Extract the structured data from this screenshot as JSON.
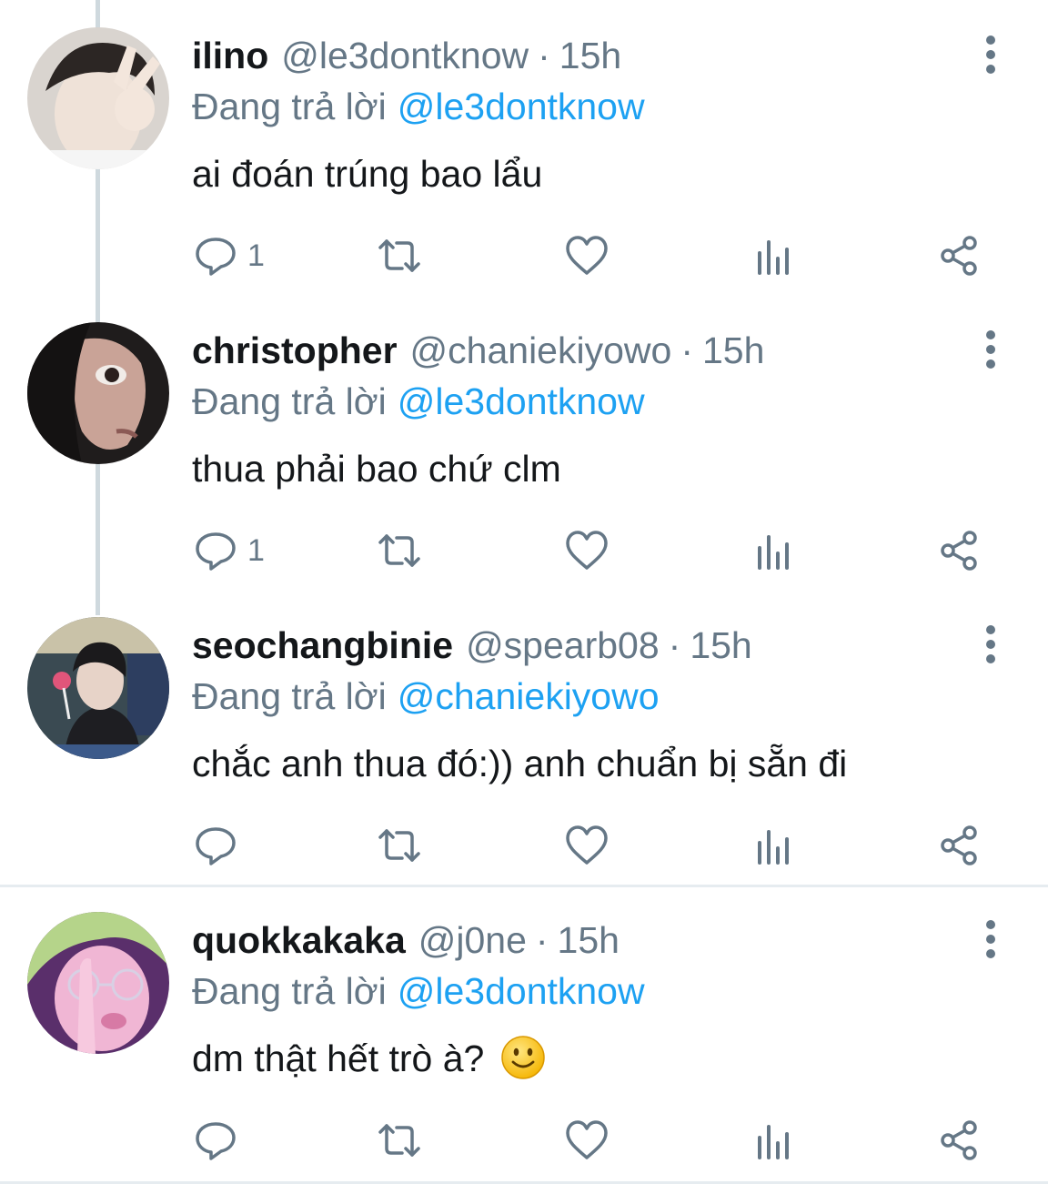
{
  "tweets": [
    {
      "name": "ilino",
      "handle": "@le3dontknow",
      "dot": "·",
      "time": "15h",
      "reply_prefix": "Đang trả lời",
      "reply_to": "@le3dontknow",
      "text": "ai đoán trúng bao lẩu",
      "reply_count": "1",
      "avatar_colors": {
        "bg": "#d9d4cf",
        "skin": "#efe2d8",
        "hair": "#2c2624"
      }
    },
    {
      "name": "christopher",
      "handle": "@chaniekiyowo",
      "dot": "·",
      "time": "15h",
      "reply_prefix": "Đang trả lời",
      "reply_to": "@le3dontknow",
      "text": "thua phải bao chứ clm",
      "reply_count": "1",
      "avatar_colors": {
        "bg": "#1f1c1c",
        "skin": "#c9a397",
        "hair": "#141212"
      }
    },
    {
      "name": "seochangbinie",
      "handle": "@spearb08",
      "dot": "·",
      "time": "15h",
      "reply_prefix": "Đang trả lời",
      "reply_to": "@chaniekiyowo",
      "text": "chắc anh thua đó:)) anh chuẩn bị sẵn đi",
      "reply_count": "",
      "avatar_colors": {
        "bg": "#3a4a52",
        "skin": "#e7d3c8",
        "hair": "#1b1a1c"
      }
    },
    {
      "name": "quokkakaka",
      "handle": "@j0ne",
      "dot": "·",
      "time": "15h",
      "reply_prefix": "Đang trả lời",
      "reply_to": "@le3dontknow",
      "text": "dm thật hết trò à?",
      "emoji": "slightly-smiling-face",
      "reply_count": "",
      "avatar_colors": {
        "bg": "#5a2f6b",
        "skin": "#f0b6d4",
        "hair": "#b5d48a"
      }
    }
  ],
  "icons": {
    "reply": "reply-icon",
    "retweet": "retweet-icon",
    "like": "heart-icon",
    "analytics": "analytics-icon",
    "share": "share-icon",
    "more": "more-vertical-icon"
  },
  "colors": {
    "text": "#14171a",
    "secondary": "#657786",
    "link": "#1da1f2",
    "thread_line": "#cfd9de",
    "divider": "#e6ecf0"
  }
}
